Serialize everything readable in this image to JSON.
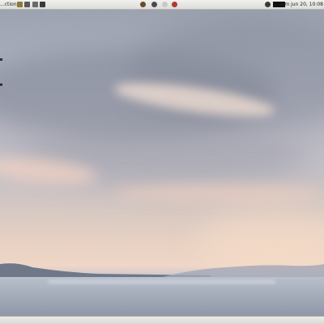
{
  "top_panel": {
    "menu_label": "...ctions",
    "clock": "dim jun 20, 10:08",
    "launchers": [
      {
        "icon": "text-editor-icon",
        "color": "#8c7a3c"
      },
      {
        "icon": "help-icon",
        "color": "#5a5a5a"
      },
      {
        "icon": "search-icon",
        "color": "#6a6a6a"
      },
      {
        "icon": "terminal-icon",
        "color": "#3a3a3a"
      }
    ],
    "tray": [
      {
        "icon": "ubuntu-logo-icon",
        "color": "#6b4a2b"
      },
      {
        "icon": "image-viewer-icon",
        "color": "#4a4a4a"
      },
      {
        "icon": "notes-icon",
        "color": "#c9c9c9"
      },
      {
        "icon": "ssh-icon",
        "color": "#b03a2e"
      }
    ],
    "status_icons": [
      {
        "icon": "network-icon",
        "color": "#3a3a3a"
      },
      {
        "icon": "volume-icon",
        "color": "#111111"
      }
    ]
  },
  "colors": {
    "panel": "#e8e8e6",
    "sky_top": "#9aa0ae",
    "horizon": "#efd6c6",
    "sea": "#9aa3b1"
  }
}
